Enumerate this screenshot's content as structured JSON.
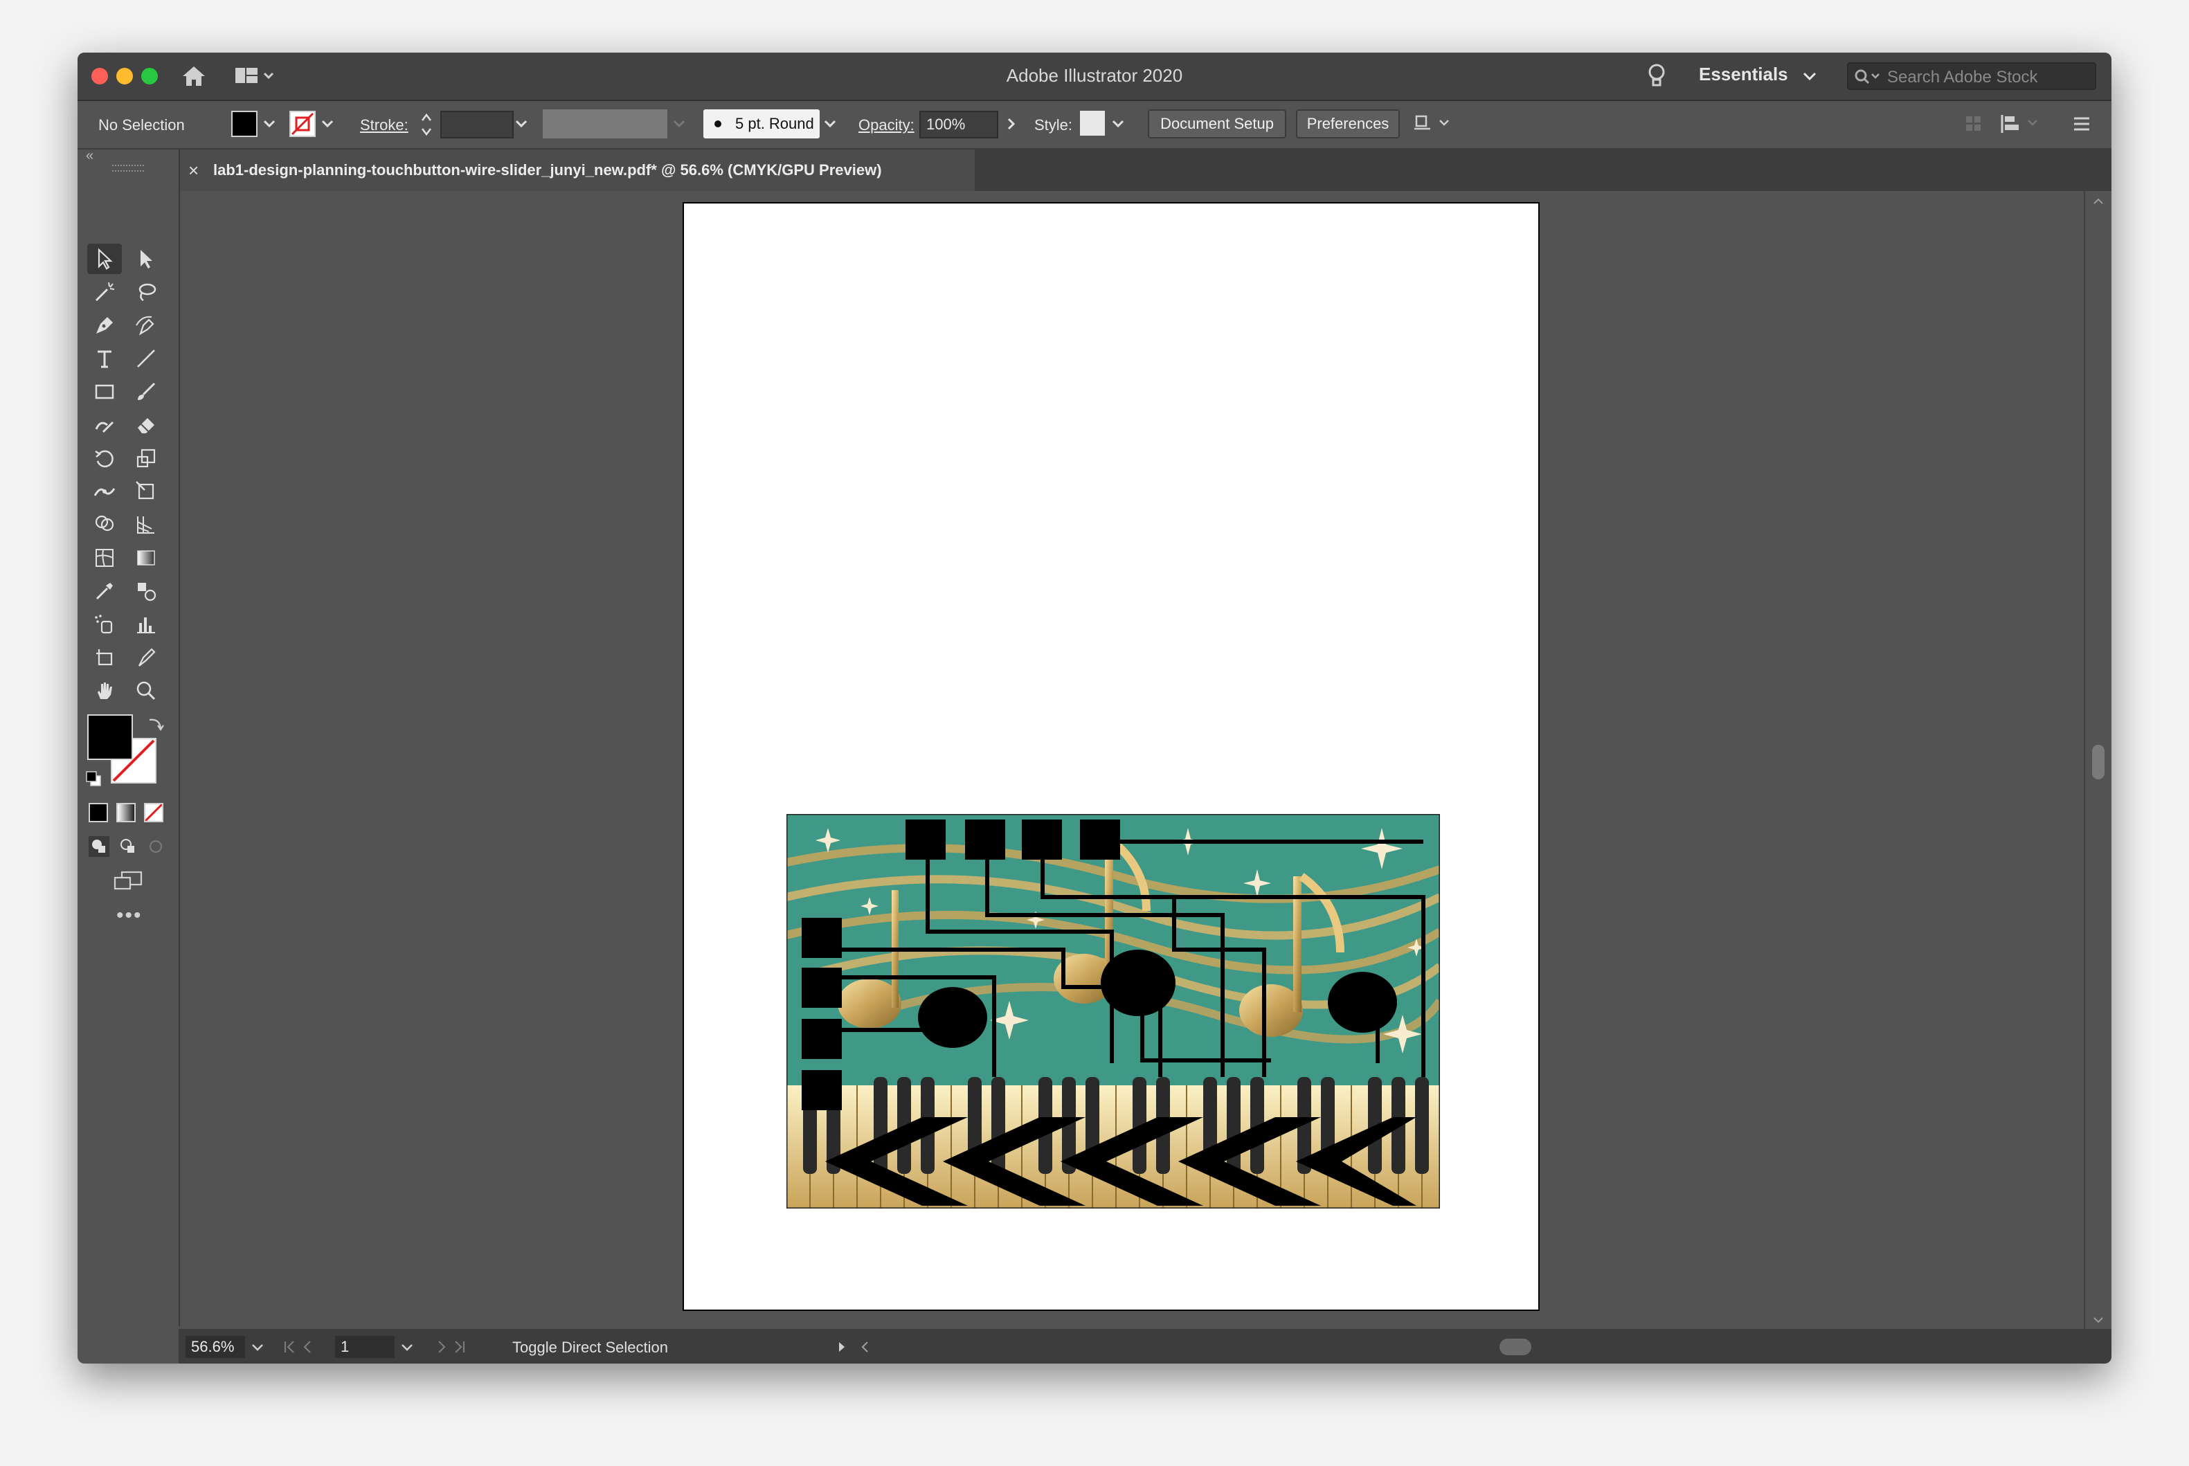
{
  "app": {
    "title": "Adobe Illustrator 2020",
    "workspace": "Essentials",
    "stock_search_placeholder": "Search Adobe Stock"
  },
  "control_bar": {
    "selection_state": "No Selection",
    "stroke_label": "Stroke:",
    "brush": "5 pt. Round",
    "opacity_label": "Opacity:",
    "opacity_value": "100%",
    "style_label": "Style:",
    "document_setup": "Document Setup",
    "preferences": "Preferences"
  },
  "document_tab": {
    "close": "×",
    "title": "lab1-design-planning-touchbutton-wire-slider_junyi_new.pdf* @ 56.6% (CMYK/GPU Preview)"
  },
  "tools": [
    "selection-tool",
    "direct-selection-tool",
    "magic-wand-tool",
    "lasso-tool",
    "pen-tool",
    "curvature-tool",
    "type-tool",
    "line-segment-tool",
    "rectangle-tool",
    "paintbrush-tool",
    "shaper-tool",
    "eraser-tool",
    "rotate-tool",
    "scale-tool",
    "width-tool",
    "free-transform-tool",
    "shape-builder-tool",
    "perspective-grid-tool",
    "mesh-tool",
    "gradient-tool",
    "eyedropper-tool",
    "blend-tool",
    "symbol-sprayer-tool",
    "column-graph-tool",
    "artboard-tool",
    "slice-tool",
    "hand-tool",
    "zoom-tool"
  ],
  "status_bar": {
    "zoom": "56.6%",
    "artboard_number": "1",
    "status_text": "Toggle Direct Selection"
  },
  "colors": {
    "ui_background": "#535353",
    "titlebar": "#424242",
    "artwork_teal": "#3f9986",
    "artwork_gold": "#c9a45a",
    "artwork_cream": "#f5e6b0"
  }
}
